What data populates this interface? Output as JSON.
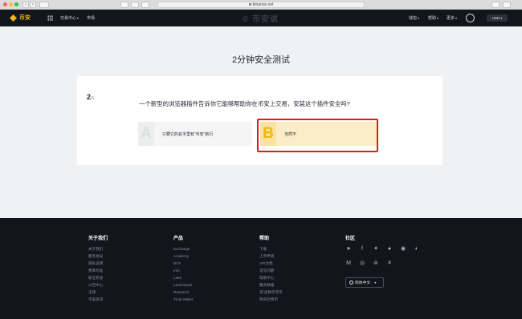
{
  "browser": {
    "url": "binance.net",
    "buttons": {
      "back": "‹",
      "forward": "›"
    }
  },
  "header": {
    "logo_text": "币安",
    "nav": {
      "trade_center": "交易中心",
      "market": "市场",
      "wallet": "钱包",
      "help": "帮助",
      "more": "更多"
    },
    "watermark": "© 币安说",
    "currency": "USD"
  },
  "quiz": {
    "page_title": "2分钟安全测试",
    "current": "2",
    "total": "/5",
    "question": "一个新型的浏览器插件告诉你它能够帮助你在币安上交易，安装这个插件安全吗?",
    "options": [
      {
        "letter": "A",
        "label": "只要它的名字里有“币安”就行"
      },
      {
        "letter": "B",
        "label": "当然不"
      }
    ]
  },
  "footer": {
    "columns": [
      {
        "title": "关于我们",
        "links": [
          "关于我们",
          "服务协议",
          "隐私说明",
          "费率标准",
          "职业机会",
          "公告中心",
          "法律",
          "币安资讯"
        ]
      },
      {
        "title": "产品",
        "links": [
          "Exchange",
          "Academy",
          "BCF",
          "Info",
          "Labs",
          "Launchpad",
          "Research",
          "Trust Wallet"
        ]
      },
      {
        "title": "帮助",
        "links": [
          "下载",
          "上币申请",
          "API文档",
          "常见问题",
          "帮助中心",
          "服务联络",
          "买/卖数字货币",
          "购买比特币"
        ]
      }
    ],
    "community_title": "社区",
    "language": "简体中文"
  },
  "icons": {
    "social_row1": [
      "telegram-icon",
      "facebook-icon",
      "twitter-icon",
      "reddit-icon",
      "weibo-icon",
      "coinmarketcap-icon"
    ],
    "social_row2": [
      "medium-icon",
      "instagram-icon",
      "steemit-icon",
      "vk-icon"
    ]
  },
  "colors": {
    "brand": "#f0b90b",
    "header_bg": "#12161c",
    "highlight": "#e01b1b",
    "option_b_bg": "#fbedc7"
  }
}
